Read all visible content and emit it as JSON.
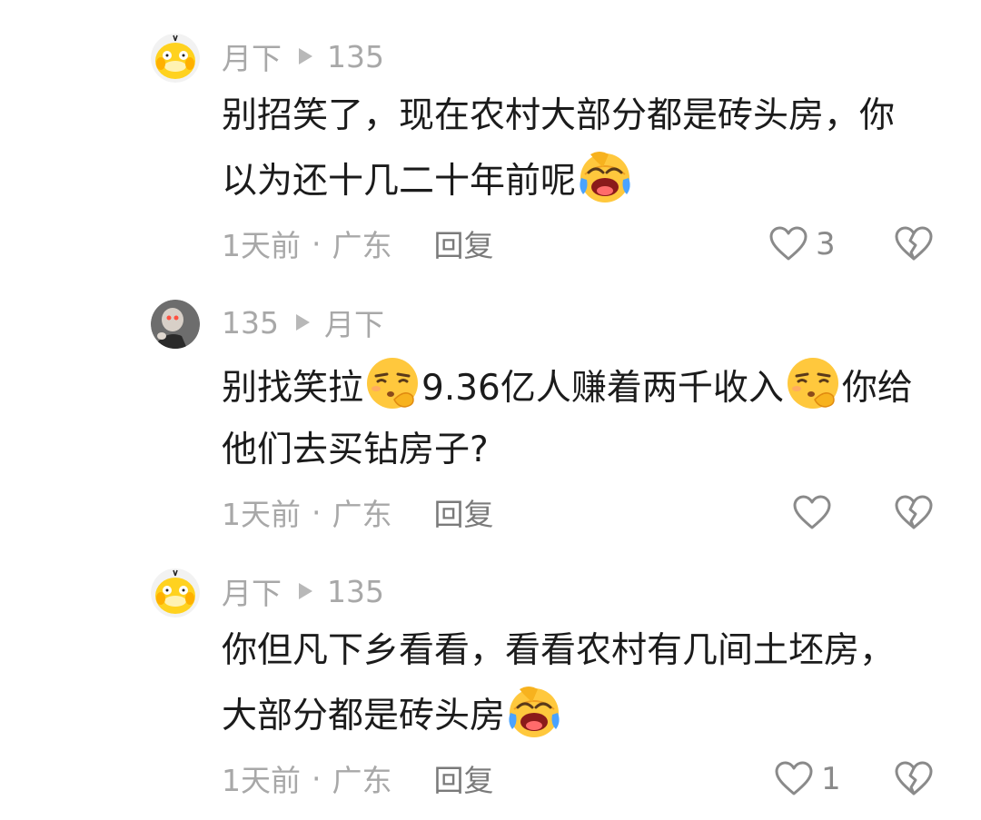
{
  "comments": [
    {
      "author": "月下",
      "reply_to": "135",
      "text_lines": [
        "别招笑了，现在农村大部分都是砖头房，你",
        "以为还十几二十年前呢"
      ],
      "emoji_line2": "laughing-crying-emoji",
      "time": "1天前",
      "location": "广东",
      "reply_label": "回复",
      "likes": "3"
    },
    {
      "author": "135",
      "reply_to": "月下",
      "text_line1_parts": [
        "别找笑拉",
        "9.36亿人赚着两千收入",
        "你给"
      ],
      "text_line2": "他们去买钻房子?",
      "emoji": "sleepy-pondering-emoji",
      "time": "1天前",
      "location": "广东",
      "reply_label": "回复",
      "likes": ""
    },
    {
      "author": "月下",
      "reply_to": "135",
      "text_lines": [
        "你但凡下乡看看，看看农村有几间土坯房，",
        "大部分都是砖头房"
      ],
      "emoji_line2": "laughing-crying-emoji",
      "time": "1天前",
      "location": "广东",
      "reply_label": "回复",
      "likes": "1"
    }
  ],
  "separator": "·",
  "icons": {
    "reply_arrow": "play-arrow-icon",
    "like": "heart-outline-icon",
    "dislike": "broken-heart-icon"
  },
  "colors": {
    "text": "#1b1b1b",
    "muted": "#a8a8a8",
    "icon": "#8a8a8a"
  }
}
